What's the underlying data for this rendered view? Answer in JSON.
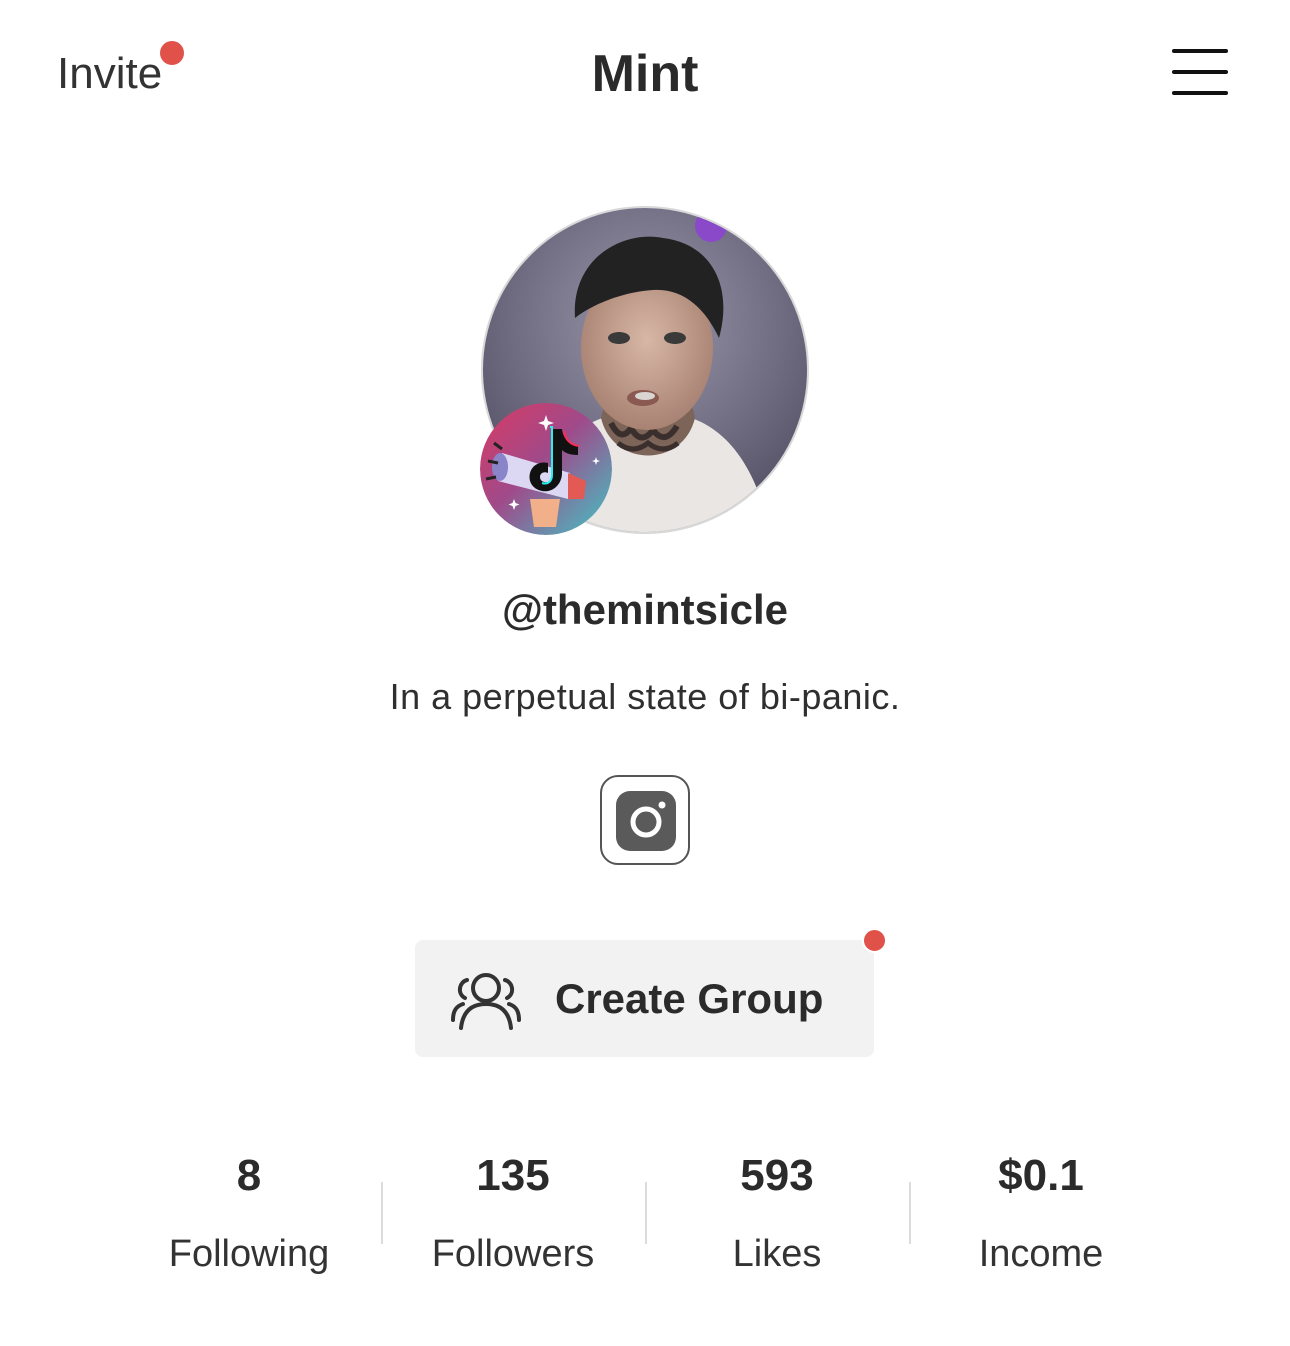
{
  "header": {
    "invite_label": "Invite",
    "title": "Mint",
    "menu_icon": "hamburger-icon",
    "notification_color": "#e0514a"
  },
  "profile": {
    "avatar_icon": "profile-photo",
    "badge_icon": "tiktok-promote-badge-icon",
    "username": "@themintsicle",
    "bio": "In a perpetual state of bi-panic."
  },
  "social": {
    "instagram_icon": "instagram-icon"
  },
  "create_group": {
    "label": "Create Group",
    "icon": "group-icon",
    "has_notification": true
  },
  "stats": [
    {
      "value": "8",
      "label": "Following"
    },
    {
      "value": "135",
      "label": "Followers"
    },
    {
      "value": "593",
      "label": "Likes"
    },
    {
      "value": "$0.1",
      "label": "Income"
    }
  ]
}
